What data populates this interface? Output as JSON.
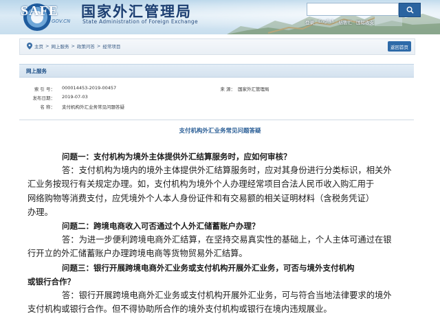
{
  "header": {
    "logo_text": "SAFE",
    "logo_gov": "GOV.CN",
    "title": "国家外汇管理局",
    "subtitle": "State Administration of Foreign Exchange",
    "links": [
      "登录",
      "English",
      "结售汇",
      "国际收支"
    ]
  },
  "breadcrumb": {
    "items": [
      "主页",
      "网上服务",
      "政策问答",
      "经常项目"
    ],
    "sep": ">"
  },
  "back_button": "返回首页",
  "section": "网上服务",
  "meta": {
    "index_label": "索 引 号：",
    "index_value": "000014453-2019-00457",
    "source_label": "来      源：",
    "source_value": "国家外汇管理局",
    "date_label": "发布日期：",
    "date_value": "2019-07-03",
    "name_label": "名      称：",
    "name_value": "支付机构外汇业务常见问题答疑"
  },
  "doc_title": "支付机构外汇业务常见问题答疑",
  "qa": [
    {
      "q": "问题一：支付机构为境外主体提供外汇结算服务时，应如何审核？",
      "a": [
        "答：支付机构为境内的境外主体提供外汇结算服务时，应对其身份进行分类标识，相关外",
        "汇业务按现行有关规定办理。如，支付机构为境外个人办理经常项目合法人民币收入购汇用于",
        "网络购物等消费支付，应凭境外个人本人身份证件和有交易额的相关证明材料（含税务凭证）",
        "办理。"
      ]
    },
    {
      "q": "问题二：跨境电商收入可否通过个人外汇储蓄账户办理？",
      "a": [
        "答：为进一步便利跨境电商外汇结算，在坚持交易真实性的基础上，个人主体可通过在银",
        "行开立的外汇储蓄账户办理跨境电商等货物贸易外汇结算。"
      ]
    },
    {
      "q1": "问题三：银行开展跨境电商外汇业务或支付机构开展外汇业务，可否与境外支付机构",
      "q2": "或银行合作？",
      "a": [
        "答：银行开展跨境电商外汇业务或支付机构开展外汇业务，可与符合当地法律要求的境外",
        "支付机构或银行合作。但不得协助所合作的境外支付机构或银行在境内违规展业。"
      ]
    }
  ]
}
